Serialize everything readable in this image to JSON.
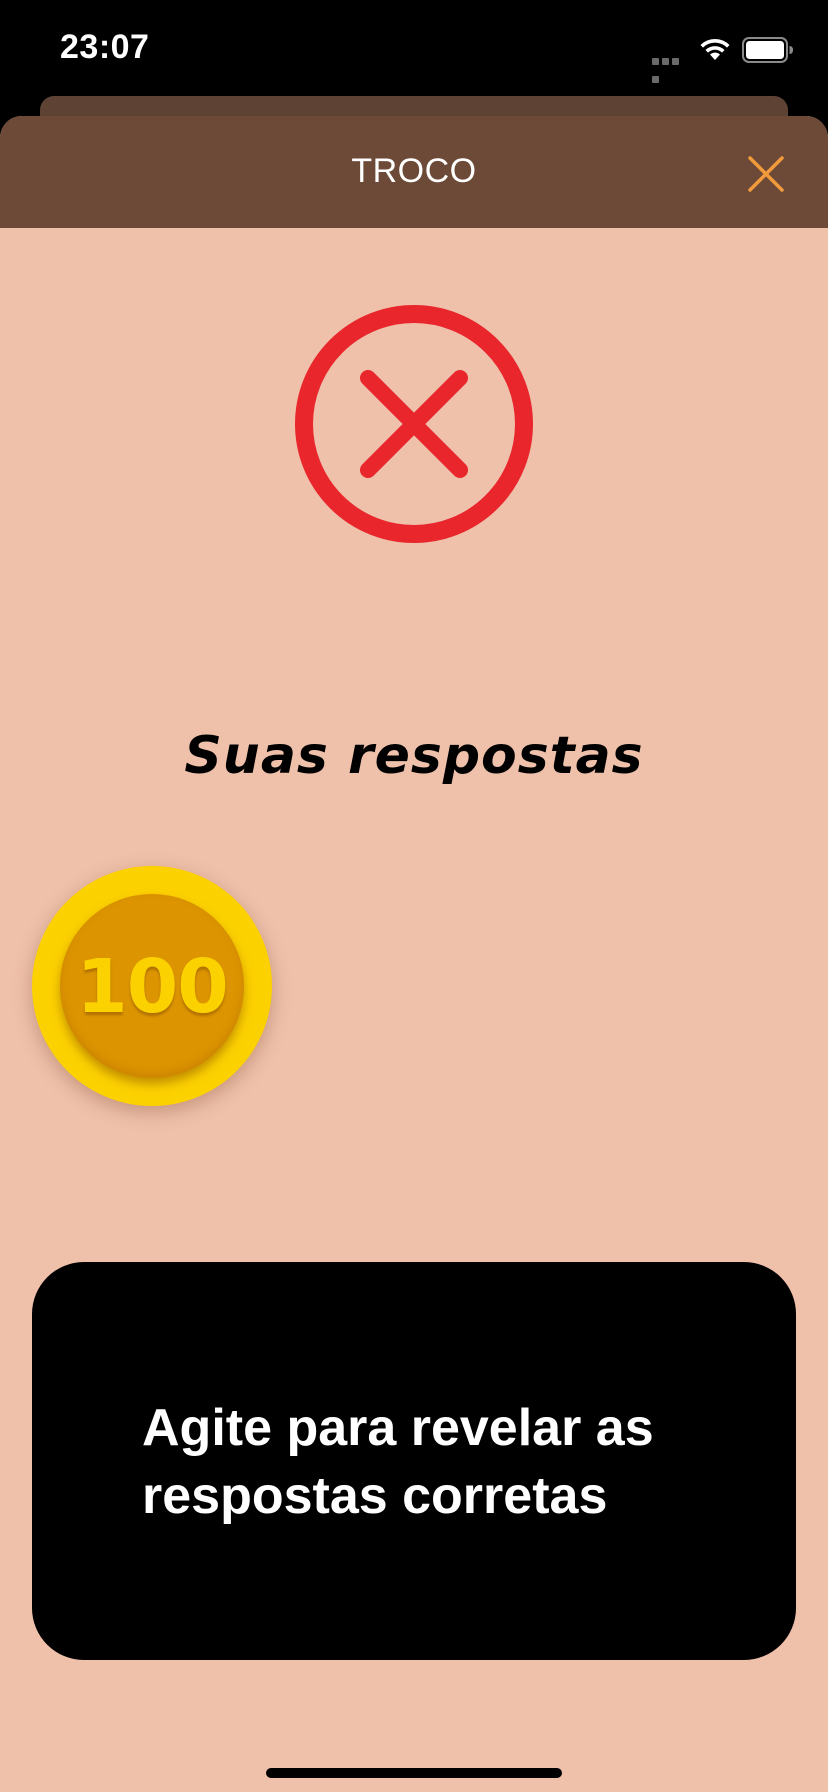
{
  "status_bar": {
    "time": "23:07"
  },
  "nav": {
    "title": "TROCO",
    "close_icon": "close-icon",
    "accent_color": "#f29a3c"
  },
  "result": {
    "icon": "wrong-answer-icon",
    "icon_color": "#e8262c"
  },
  "answers": {
    "heading": "Suas respostas",
    "items": [
      {
        "value": "100"
      }
    ]
  },
  "reveal": {
    "message": "Agite para revelar as respostas corretas"
  },
  "colors": {
    "background": "#efc0aa",
    "nav_background": "#6d4a38",
    "coin_outer": "#fcd100",
    "coin_inner": "#dc9400"
  }
}
